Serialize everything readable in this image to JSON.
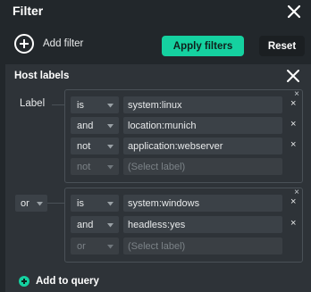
{
  "panel": {
    "title": "Filter",
    "add_filter_label": "Add filter",
    "apply_label": "Apply filters",
    "reset_label": "Reset"
  },
  "host_labels": {
    "title": "Host labels",
    "label_text": "Label",
    "group_connector": "or",
    "groups": [
      {
        "rows": [
          {
            "op": "is",
            "value": "system:linux",
            "disabled": false
          },
          {
            "op": "and",
            "value": "location:munich",
            "disabled": false
          },
          {
            "op": "not",
            "value": "application:webserver",
            "disabled": false
          },
          {
            "op": "not",
            "placeholder": "(Select label)",
            "disabled": true
          }
        ]
      },
      {
        "rows": [
          {
            "op": "is",
            "value": "system:windows",
            "disabled": false
          },
          {
            "op": "and",
            "value": "headless:yes",
            "disabled": false
          },
          {
            "op": "or",
            "placeholder": "(Select label)",
            "disabled": true
          }
        ]
      }
    ],
    "add_query_label": "Add to query"
  },
  "colors": {
    "background": "#22272b",
    "section": "#2e3338",
    "accent": "#15d1a0",
    "input": "#3b4147"
  },
  "icons": [
    "close-icon",
    "plus-circle-icon",
    "chevron-down-icon",
    "remove-x-icon",
    "add-icon"
  ]
}
